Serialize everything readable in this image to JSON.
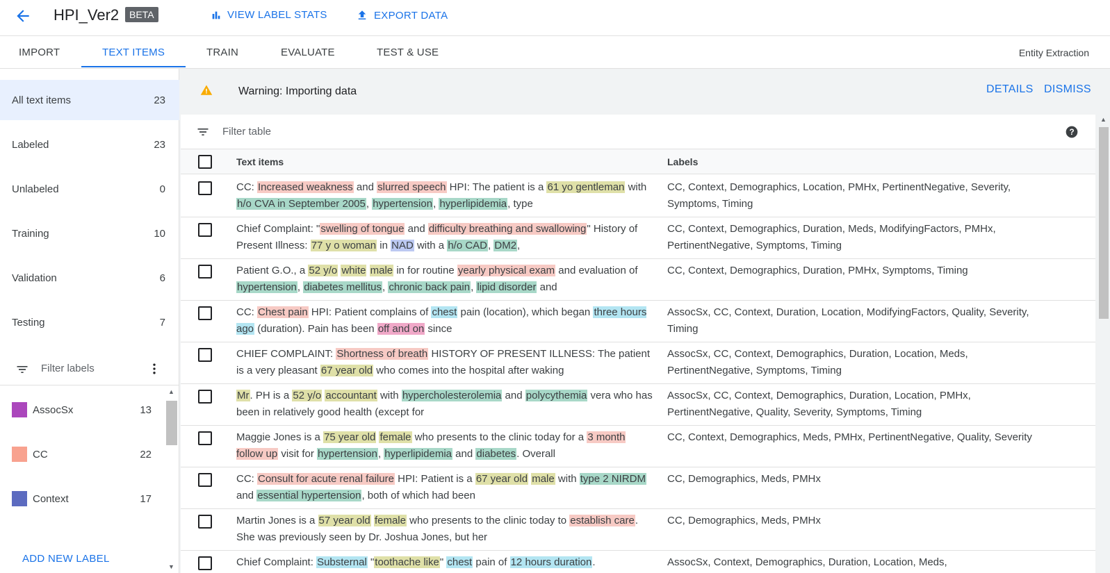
{
  "header": {
    "title": "HPI_Ver2",
    "badge": "BETA",
    "view_stats": "VIEW LABEL STATS",
    "export": "EXPORT DATA"
  },
  "tabs": [
    {
      "label": "IMPORT"
    },
    {
      "label": "TEXT ITEMS"
    },
    {
      "label": "TRAIN"
    },
    {
      "label": "EVALUATE"
    },
    {
      "label": "TEST & USE"
    }
  ],
  "entity_type": "Entity Extraction",
  "sidebar": {
    "items": [
      {
        "label": "All text items",
        "count": "23"
      },
      {
        "label": "Labeled",
        "count": "23"
      },
      {
        "label": "Unlabeled",
        "count": "0"
      },
      {
        "label": "Training",
        "count": "10"
      },
      {
        "label": "Validation",
        "count": "6"
      },
      {
        "label": "Testing",
        "count": "7"
      }
    ],
    "filter_labels_placeholder": "Filter labels",
    "labels": [
      {
        "name": "AssocSx",
        "count": "13",
        "color": "#ab47bc"
      },
      {
        "name": "CC",
        "count": "22",
        "color": "#f8a28f"
      },
      {
        "name": "Context",
        "count": "17",
        "color": "#5c6bc0"
      }
    ],
    "add_label": "ADD NEW LABEL"
  },
  "warning": {
    "text": "Warning: Importing data",
    "details": "DETAILS",
    "dismiss": "DISMISS"
  },
  "table": {
    "filter_placeholder": "Filter table",
    "headers": {
      "text": "Text items",
      "labels": "Labels"
    },
    "rows": [
      {
        "segments": [
          [
            "CC: ",
            ""
          ],
          [
            "Increased weakness",
            "sym"
          ],
          [
            " and ",
            ""
          ],
          [
            "slurred speech",
            "sym"
          ],
          [
            " HPI: The patient is a ",
            ""
          ],
          [
            "61 yo gentleman",
            "demo"
          ],
          [
            " with ",
            ""
          ],
          [
            "h/o CVA in September 2005",
            "pmhx"
          ],
          [
            ", ",
            ""
          ],
          [
            "hypertension",
            "pmhx"
          ],
          [
            ", ",
            ""
          ],
          [
            "hyperlipidemia",
            "pmhx"
          ],
          [
            ", type",
            ""
          ]
        ],
        "labels": "CC, Context, Demographics, Location, PMHx, PertinentNegative, Severity, Symptoms, Timing"
      },
      {
        "segments": [
          [
            "Chief Complaint: \"",
            ""
          ],
          [
            "swelling of tongue",
            "sym"
          ],
          [
            " and ",
            ""
          ],
          [
            "difficulty breathing and swallowing",
            "sym"
          ],
          [
            "\" History of Present Illness: ",
            ""
          ],
          [
            "77 y o woman",
            "demo"
          ],
          [
            " in ",
            ""
          ],
          [
            "NAD",
            "meds"
          ],
          [
            " with a ",
            ""
          ],
          [
            "h/o CAD",
            "pmhx"
          ],
          [
            ", ",
            ""
          ],
          [
            "DM2",
            "pmhx"
          ],
          [
            ",",
            ""
          ]
        ],
        "labels": "CC, Context, Demographics, Duration, Meds, ModifyingFactors, PMHx, PertinentNegative, Symptoms, Timing"
      },
      {
        "segments": [
          [
            "Patient G.O., a ",
            ""
          ],
          [
            "52 y/o",
            "demo"
          ],
          [
            " ",
            ""
          ],
          [
            "white",
            "demo"
          ],
          [
            " ",
            ""
          ],
          [
            "male",
            "demo"
          ],
          [
            " in for routine ",
            ""
          ],
          [
            "yearly physical exam",
            "sym"
          ],
          [
            " and evaluation of ",
            ""
          ],
          [
            "hypertension",
            "pmhx"
          ],
          [
            ", ",
            ""
          ],
          [
            "diabetes mellitus",
            "pmhx"
          ],
          [
            ", ",
            ""
          ],
          [
            "chronic back pain",
            "pmhx"
          ],
          [
            ", ",
            ""
          ],
          [
            "lipid disorder",
            "pmhx"
          ],
          [
            " and",
            ""
          ]
        ],
        "labels": "CC, Context, Demographics, Duration, PMHx, Symptoms, Timing"
      },
      {
        "segments": [
          [
            "CC: ",
            ""
          ],
          [
            "Chest pain",
            "sym"
          ],
          [
            " HPI: Patient complains of ",
            ""
          ],
          [
            "chest",
            "loc"
          ],
          [
            " pain (location), which began ",
            ""
          ],
          [
            "three hours ago",
            "loc"
          ],
          [
            " (duration).  Pain has been ",
            ""
          ],
          [
            "off and on",
            "time"
          ],
          [
            " since",
            ""
          ]
        ],
        "labels": "AssocSx, CC, Context, Duration, Location, ModifyingFactors, Quality, Severity, Timing"
      },
      {
        "segments": [
          [
            "CHIEF COMPLAINT: ",
            ""
          ],
          [
            "Shortness of breath",
            "sym"
          ],
          [
            " HISTORY OF PRESENT ILLNESS: The patient is a very pleasant ",
            ""
          ],
          [
            "67 year old",
            "demo"
          ],
          [
            " who comes into the hospital after waking",
            ""
          ]
        ],
        "labels": "AssocSx, CC, Context, Demographics, Duration, Location, Meds, PertinentNegative, Symptoms, Timing"
      },
      {
        "segments": [
          [
            "Mr",
            "demo"
          ],
          [
            ". PH is a ",
            ""
          ],
          [
            "52 y/o",
            "demo"
          ],
          [
            " ",
            ""
          ],
          [
            "accountant",
            "demo"
          ],
          [
            " with ",
            ""
          ],
          [
            "hypercholesterolemia",
            "pmhx"
          ],
          [
            " and ",
            ""
          ],
          [
            "polycythemia",
            "pmhx"
          ],
          [
            " vera who has been in relatively good health (except for",
            ""
          ]
        ],
        "labels": "AssocSx, CC, Context, Demographics, Duration, Location, PMHx, PertinentNegative, Quality, Severity, Symptoms, Timing"
      },
      {
        "segments": [
          [
            "Maggie Jones is a ",
            ""
          ],
          [
            "75 year old",
            "demo"
          ],
          [
            " ",
            ""
          ],
          [
            "female",
            "demo"
          ],
          [
            " who presents to the clinic today for a ",
            ""
          ],
          [
            "3 month follow up",
            "sym"
          ],
          [
            " visit for ",
            ""
          ],
          [
            "hypertension",
            "pmhx"
          ],
          [
            ", ",
            ""
          ],
          [
            "hyperlipidemia",
            "pmhx"
          ],
          [
            " and ",
            ""
          ],
          [
            "diabetes",
            "pmhx"
          ],
          [
            ". Overall",
            ""
          ]
        ],
        "labels": "CC, Context, Demographics, Meds, PMHx, PertinentNegative, Quality, Severity"
      },
      {
        "segments": [
          [
            "CC: ",
            ""
          ],
          [
            "Consult for acute renal failure",
            "sym"
          ],
          [
            " HPI: Patient is a ",
            ""
          ],
          [
            "67 year old",
            "demo"
          ],
          [
            " ",
            ""
          ],
          [
            "male",
            "demo"
          ],
          [
            " with ",
            ""
          ],
          [
            "type 2 NIRDM",
            "pmhx"
          ],
          [
            " and ",
            ""
          ],
          [
            "essential hypertension",
            "pmhx"
          ],
          [
            ", both of which had been",
            ""
          ]
        ],
        "labels": "CC, Demographics, Meds, PMHx"
      },
      {
        "segments": [
          [
            "Martin Jones is a ",
            ""
          ],
          [
            "57 year old",
            "demo"
          ],
          [
            " ",
            ""
          ],
          [
            "female",
            "demo"
          ],
          [
            " who presents to the clinic today to ",
            ""
          ],
          [
            "establish care",
            "sym"
          ],
          [
            ". She was previously seen by Dr. Joshua Jones, but her",
            ""
          ]
        ],
        "labels": "CC, Demographics, Meds, PMHx"
      },
      {
        "segments": [
          [
            "Chief Complaint: ",
            ""
          ],
          [
            "Substernal",
            "loc"
          ],
          [
            " \"",
            ""
          ],
          [
            "toothache like",
            "demo"
          ],
          [
            "\" ",
            ""
          ],
          [
            "chest",
            "loc"
          ],
          [
            " pain of ",
            ""
          ],
          [
            "12 hours duration",
            "loc"
          ],
          [
            ".",
            ""
          ]
        ],
        "labels": "AssocSx, Context, Demographics, Duration, Location, Meds,"
      }
    ]
  }
}
